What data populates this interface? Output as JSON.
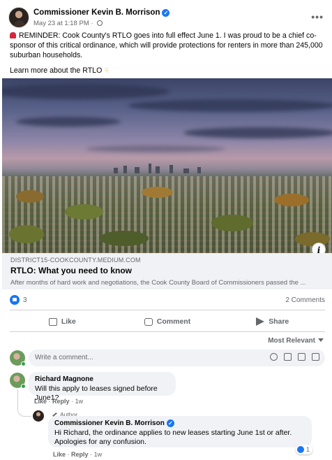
{
  "post": {
    "author": "Commissioner Kevin B. Morrison",
    "timestamp": "May 23 at 1:18 PM",
    "separator": "·",
    "paragraph1": "REMINDER: Cook County's RTLO goes into full effect June 1. I was proud to be a chief co-sponsor of this critical ordinance, which will provide protections for renters in more than 245,000 suburban households.",
    "paragraph2": "Learn more about the RTLO",
    "more_icon": "more-options-icon",
    "info_label": "i"
  },
  "link": {
    "domain": "DISTRICT15-COOKCOUNTY.MEDIUM.COM",
    "title": "RTLO: What you need to know",
    "description": "After months of hard work and negotiations, the Cook County Board of Commissioners passed the ..."
  },
  "stats": {
    "reactions": "3",
    "comments": "2 Comments"
  },
  "actions": {
    "like": "Like",
    "comment": "Comment",
    "share": "Share"
  },
  "sort": {
    "label": "Most Relevant"
  },
  "compose": {
    "placeholder": "Write a comment..."
  },
  "comments": [
    {
      "name": "Richard Magnone",
      "text": "Will this apply to leases signed before June1?",
      "like": "Like",
      "reply": "Reply",
      "age": "1w",
      "dot": "·"
    },
    {
      "tag": "Author",
      "name": "Commissioner Kevin B. Morrison",
      "text": "Hi Richard, the ordinance applies to new leases starting June 1st or after. Apologies for any confusion.",
      "like": "Like",
      "reply": "Reply",
      "age": "1w",
      "dot": "·",
      "reactions": "1"
    }
  ],
  "colors": {
    "accent": "#1877f2",
    "secondary_text": "#65676b",
    "bubble_bg": "#f0f2f5",
    "online": "#31a24c"
  }
}
